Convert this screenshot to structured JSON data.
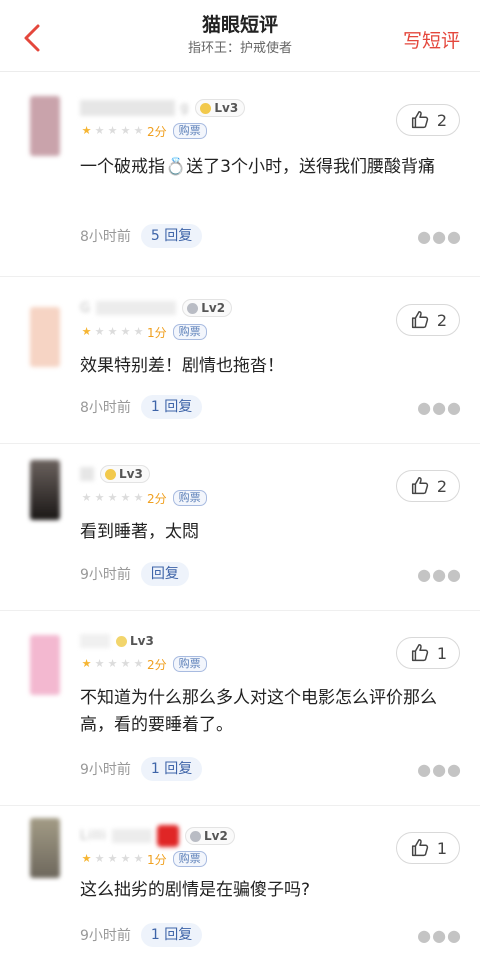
{
  "header": {
    "title": "猫眼短评",
    "subtitle": "指环王：护戒使者",
    "write_label": "写短评",
    "back_icon": "chevron-left-icon"
  },
  "colors": {
    "accent": "#e4473c",
    "reply_text": "#3e64a8",
    "star": "#f6b532"
  },
  "comments": [
    {
      "username": "g",
      "level": "Lv3",
      "level_color": "#f2c94c",
      "stars_filled": 1,
      "score": "2分",
      "ticket": "购票",
      "content": "一个破戒指💍送了3个小时，送得我们腰酸背痛",
      "time": "8小时前",
      "reply": "5 回复",
      "likes": "2",
      "avatar_color": "#c9a3ab"
    },
    {
      "username": "G",
      "level": "Lv2",
      "level_color": "#b9bcc4",
      "stars_filled": 1,
      "score": "1分",
      "ticket": "购票",
      "content": "效果特别差！剧情也拖沓！",
      "time": "8小时前",
      "reply": "1 回复",
      "likes": "2",
      "avatar_color": "#f6d4c4"
    },
    {
      "username": "",
      "level": "Lv3",
      "level_color": "#f2c94c",
      "stars_filled": 0,
      "score": "2分",
      "ticket": "购票",
      "content": "看到睡著，太悶",
      "time": "9小时前",
      "reply": "回复",
      "likes": "2",
      "avatar_color": "#3a3533"
    },
    {
      "username": "",
      "level": "Lv3",
      "level_color": "#f2c94c",
      "stars_filled": 1,
      "score": "2分",
      "ticket": "购票",
      "content": "不知道为什么那么多人对这个电影怎么评价那么高，看的要睡着了。",
      "time": "9小时前",
      "reply": "1 回复",
      "likes": "1",
      "avatar_color": "#f3b8d0"
    },
    {
      "username": "Lilli",
      "level": "Lv2",
      "level_color": "#b9bcc4",
      "stars_filled": 1,
      "score": "1分",
      "ticket": "购票",
      "content": "这么拙劣的剧情是在骗傻子吗?",
      "time": "9小时前",
      "reply": "1 回复",
      "likes": "1",
      "avatar_color": "#8d8676"
    }
  ]
}
